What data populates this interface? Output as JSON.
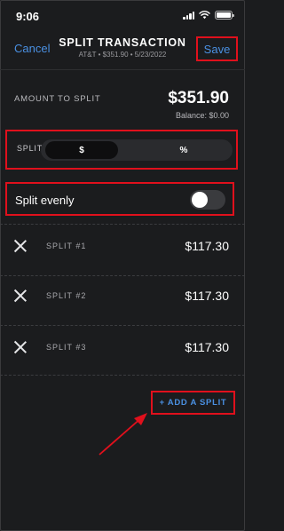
{
  "status_bar": {
    "time": "9:06"
  },
  "header": {
    "cancel_label": "Cancel",
    "title": "SPLIT TRANSACTION",
    "subtitle": "AT&T • $351.90 • 5/23/2022",
    "save_label": "Save"
  },
  "amount": {
    "label": "AMOUNT TO SPLIT",
    "value": "$351.90",
    "balance": "Balance: $0.00"
  },
  "split_by": {
    "label": "SPLIT BY",
    "options": [
      "$",
      "%"
    ],
    "selected": "$"
  },
  "split_evenly": {
    "label": "Split evenly",
    "enabled": false
  },
  "splits": [
    {
      "label": "SPLIT #1",
      "value": "$117.30"
    },
    {
      "label": "SPLIT #2",
      "value": "$117.30"
    },
    {
      "label": "SPLIT #3",
      "value": "$117.30"
    }
  ],
  "add_split_label": "+ ADD A SPLIT",
  "colors": {
    "background": "#1b1c1e",
    "accent": "#4a90e2",
    "highlight": "#e0101c"
  },
  "icons": {
    "remove": "close-icon",
    "arrow": "annotation-arrow"
  }
}
